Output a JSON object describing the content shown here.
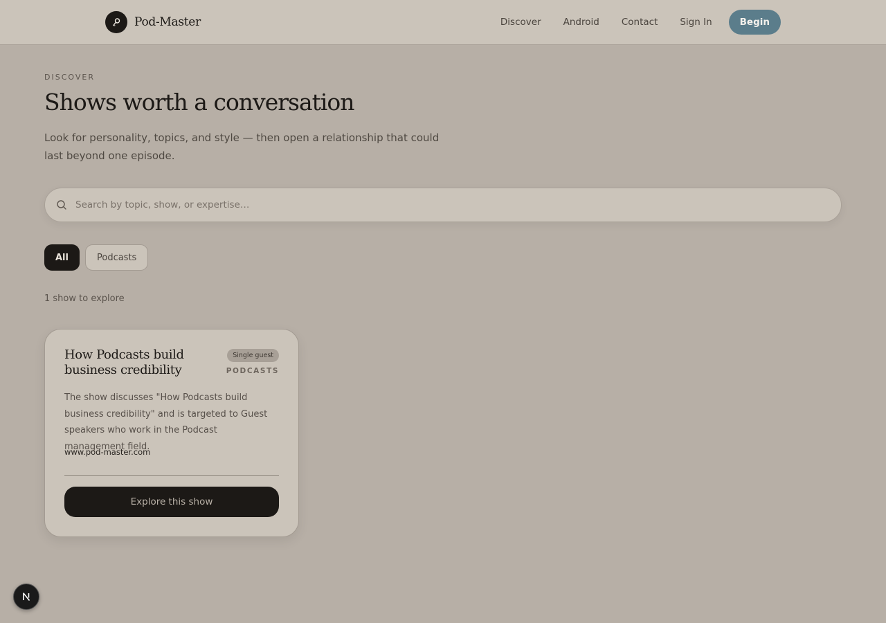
{
  "header": {
    "brand": "Pod-Master",
    "nav": {
      "discover": "Discover",
      "android": "Android",
      "contact": "Contact",
      "sign_in": "Sign In",
      "begin": "Begin"
    }
  },
  "hero": {
    "eyebrow": "DISCOVER",
    "title": "Shows worth a conversation",
    "subtitle": "Look for personality, topics, and style — then open a relationship that could last beyond one episode."
  },
  "search": {
    "placeholder": "Search by topic, show, or expertise…",
    "value": ""
  },
  "filters": {
    "all": "All",
    "podcasts": "Podcasts",
    "selected": "All"
  },
  "results_count": "1 show to explore",
  "cards": [
    {
      "title": "How Podcasts build business credibility",
      "badge": "Single guest",
      "category": "PODCASTS",
      "description": "The show discusses \"How Podcasts build business credibility\" and is targeted to Guest speakers who work in the Podcast management field.",
      "url": "www.pod-master.com",
      "cta": "Explore this show"
    }
  ],
  "colors": {
    "background": "#b7afa6",
    "surface": "#cbc4ba",
    "ink": "#1c1916",
    "accent": "#5b7d8b"
  },
  "icons": {
    "brand": "microphone-icon",
    "search": "search-icon",
    "floating": "next-logo-icon"
  }
}
